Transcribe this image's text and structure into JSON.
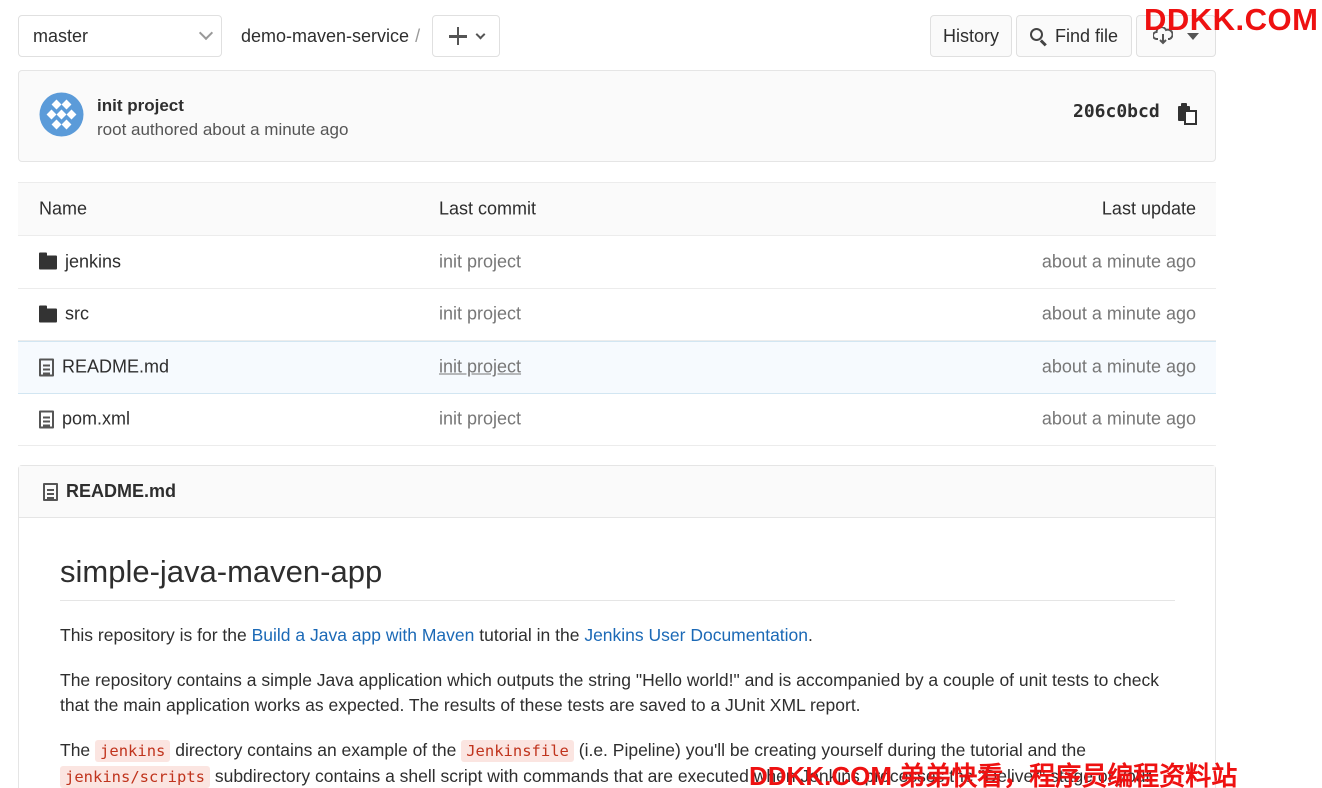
{
  "toolbar": {
    "branch": "master",
    "breadcrumb": "demo-maven-service",
    "breadcrumb_sep": "/",
    "history_label": "History",
    "find_file_label": "Find file"
  },
  "commit": {
    "title": "init project",
    "subtitle": "root authored about a minute ago",
    "sha": "206c0bcd"
  },
  "table": {
    "headers": {
      "name": "Name",
      "last_commit": "Last commit",
      "last_update": "Last update"
    },
    "rows": [
      {
        "icon": "folder-icon",
        "name": "jenkins",
        "commit": "init project",
        "update": "about a minute ago"
      },
      {
        "icon": "folder-icon",
        "name": "src",
        "commit": "init project",
        "update": "about a minute ago"
      },
      {
        "icon": "file-icon",
        "name": "README.md",
        "commit": "init project",
        "update": "about a minute ago"
      },
      {
        "icon": "file-icon",
        "name": "pom.xml",
        "commit": "init project",
        "update": "about a minute ago"
      }
    ]
  },
  "readme": {
    "filename": "README.md",
    "heading": "simple-java-maven-app",
    "p1_pre": "This repository is for the ",
    "p1_link1": "Build a Java app with Maven",
    "p1_mid": " tutorial in the ",
    "p1_link2": "Jenkins User Documentation",
    "p1_post": ".",
    "p2": "The repository contains a simple Java application which outputs the string \"Hello world!\" and is accompanied by a couple of unit tests to check that the main application works as expected. The results of these tests are saved to a JUnit XML report.",
    "p3_pre": "The ",
    "p3_code1": "jenkins",
    "p3_mid1": " directory contains an example of the ",
    "p3_code2": "Jenkinsfile",
    "p3_mid2": " (i.e. Pipeline) you'll be creating yourself during the tutorial and the ",
    "p3_code3": "jenkins/scripts",
    "p3_post": " subdirectory contains a shell script with commands that are executed when Jenkins processes the \"Deliver\" stage of your"
  },
  "watermark": {
    "top": "DDKK.COM",
    "bottom": "DDKK.COM 弟弟快看，程序员编程资料站"
  },
  "colors": {
    "link": "#1b69b6",
    "watermark": "#ee1111",
    "code": "#c0341d"
  }
}
